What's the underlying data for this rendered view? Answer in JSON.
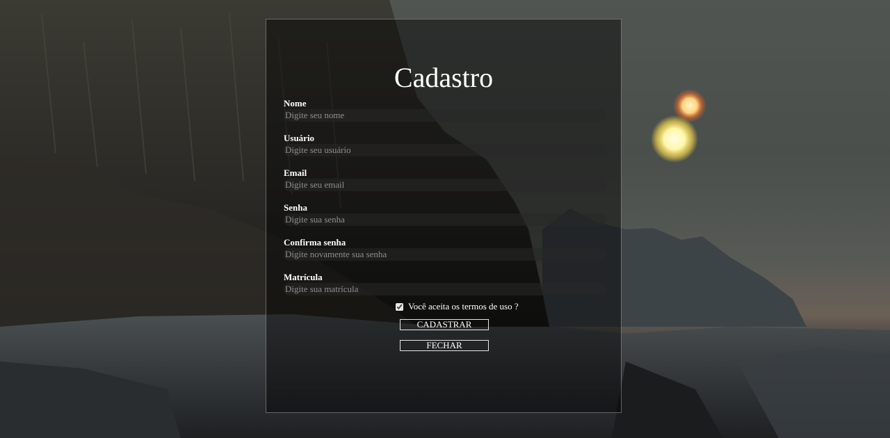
{
  "form": {
    "title": "Cadastro",
    "fields": [
      {
        "label": "Nome",
        "placeholder": "Digite seu nome",
        "value": ""
      },
      {
        "label": "Usuário",
        "placeholder": "Digite seu usuário",
        "value": ""
      },
      {
        "label": "Email",
        "placeholder": "Digite seu email",
        "value": ""
      },
      {
        "label": "Senha",
        "placeholder": "Digite sua senha",
        "value": ""
      },
      {
        "label": "Confirma senha",
        "placeholder": "Digite novamente sua senha",
        "value": ""
      },
      {
        "label": "Matrícula",
        "placeholder": "Digite sua matrícula",
        "value": ""
      }
    ],
    "terms_label": "Você aceita os termos de uso ?",
    "terms_checked": true,
    "submit_label": "CADASTRAR",
    "close_label": "FECHAR"
  },
  "colors": {
    "card_border": "#c8c8c8",
    "text": "#ffffff",
    "placeholder": "#8e8e8e"
  }
}
